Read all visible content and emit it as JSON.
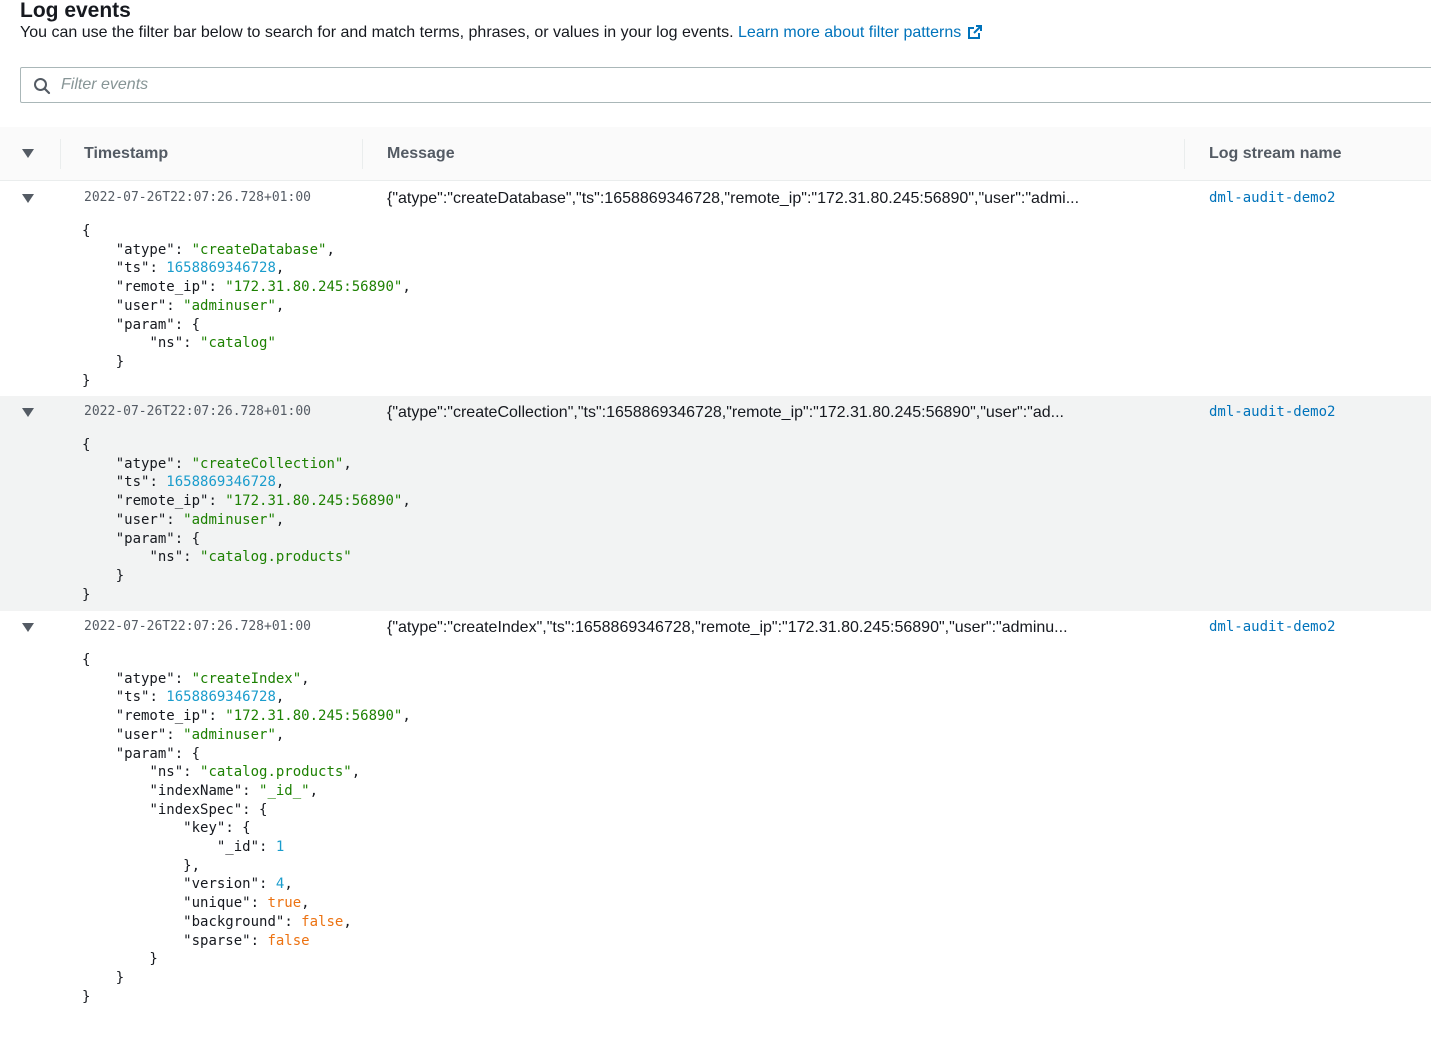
{
  "header": {
    "title": "Log events",
    "description": "You can use the filter bar below to search for and match terms, phrases, or values in your log events.",
    "learn_more_link": "Learn more about filter patterns"
  },
  "filter": {
    "placeholder": "Filter events"
  },
  "table": {
    "columns": {
      "timestamp": "Timestamp",
      "message": "Message",
      "stream": "Log stream name"
    }
  },
  "events": [
    {
      "timestamp": "2022-07-26T22:07:26.728+01:00",
      "message": "{\"atype\":\"createDatabase\",\"ts\":1658869346728,\"remote_ip\":\"172.31.80.245:56890\",\"user\":\"admi...",
      "stream": "dml-audit-demo2",
      "json": {
        "atype": "\"createDatabase\"",
        "ts": "1658869346728",
        "remote_ip": "\"172.31.80.245:56890\"",
        "user": "\"adminuser\"",
        "param_ns": "\"catalog\""
      }
    },
    {
      "timestamp": "2022-07-26T22:07:26.728+01:00",
      "message": "{\"atype\":\"createCollection\",\"ts\":1658869346728,\"remote_ip\":\"172.31.80.245:56890\",\"user\":\"ad...",
      "stream": "dml-audit-demo2",
      "json": {
        "atype": "\"createCollection\"",
        "ts": "1658869346728",
        "remote_ip": "\"172.31.80.245:56890\"",
        "user": "\"adminuser\"",
        "param_ns": "\"catalog.products\""
      }
    },
    {
      "timestamp": "2022-07-26T22:07:26.728+01:00",
      "message": "{\"atype\":\"createIndex\",\"ts\":1658869346728,\"remote_ip\":\"172.31.80.245:56890\",\"user\":\"adminu...",
      "stream": "dml-audit-demo2",
      "json": {
        "atype": "\"createIndex\"",
        "ts": "1658869346728",
        "remote_ip": "\"172.31.80.245:56890\"",
        "user": "\"adminuser\"",
        "param_ns": "\"catalog.products\"",
        "indexName": "\"_id_\"",
        "key_id": "1",
        "version": "4",
        "unique": "true",
        "background": "false",
        "sparse": "false"
      }
    }
  ]
}
